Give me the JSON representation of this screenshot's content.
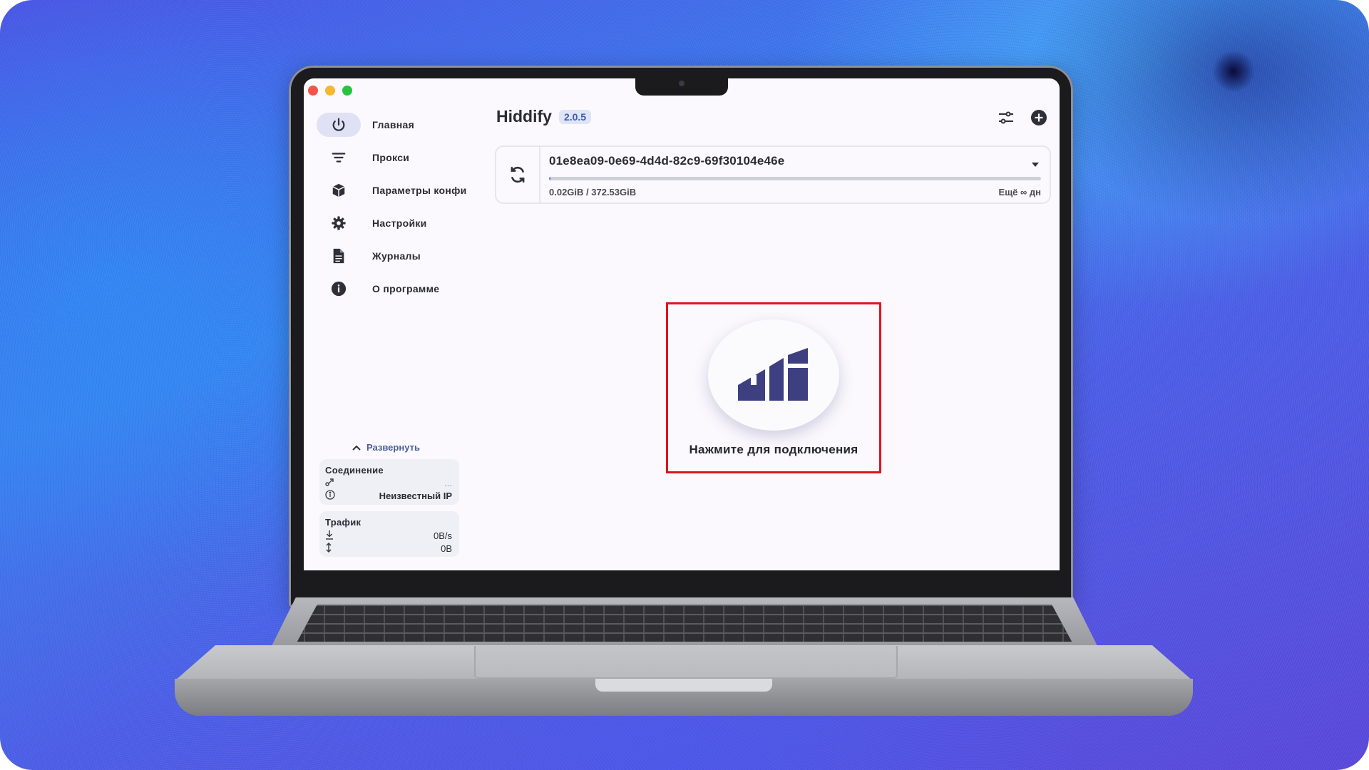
{
  "colors": {
    "accent": "#3b5fb0",
    "highlight_box": "#e0141c",
    "logo": "#3e3f80"
  },
  "window": {
    "controls": [
      "close",
      "minimize",
      "maximize"
    ]
  },
  "sidebar": {
    "items": [
      {
        "label": "Главная",
        "icon": "power-icon",
        "active": true
      },
      {
        "label": "Прокси",
        "icon": "filter-icon",
        "active": false
      },
      {
        "label": "Параметры конфи",
        "icon": "box-icon",
        "active": false
      },
      {
        "label": "Настройки",
        "icon": "gear-icon",
        "active": false
      },
      {
        "label": "Журналы",
        "icon": "file-icon",
        "active": false
      },
      {
        "label": "О программе",
        "icon": "info-icon",
        "active": false
      }
    ],
    "expand_label": "Развернуть",
    "connection": {
      "title": "Соединение",
      "route_value": "...",
      "ip_label": "Неизвестный IP"
    },
    "traffic": {
      "title": "Трафик",
      "speed": "0B/s",
      "total": "0B"
    }
  },
  "header": {
    "app_name": "Hiddify",
    "version": "2.0.5"
  },
  "profile": {
    "name": "01e8ea09-0e69-4d4d-82c9-69f30104e46e",
    "usage_text": "0.02GiB / 372.53GiB",
    "usage_fraction": 5e-05,
    "remaining_text": "Ещё ∞ дн"
  },
  "connect": {
    "label": "Нажмите для подключения"
  }
}
